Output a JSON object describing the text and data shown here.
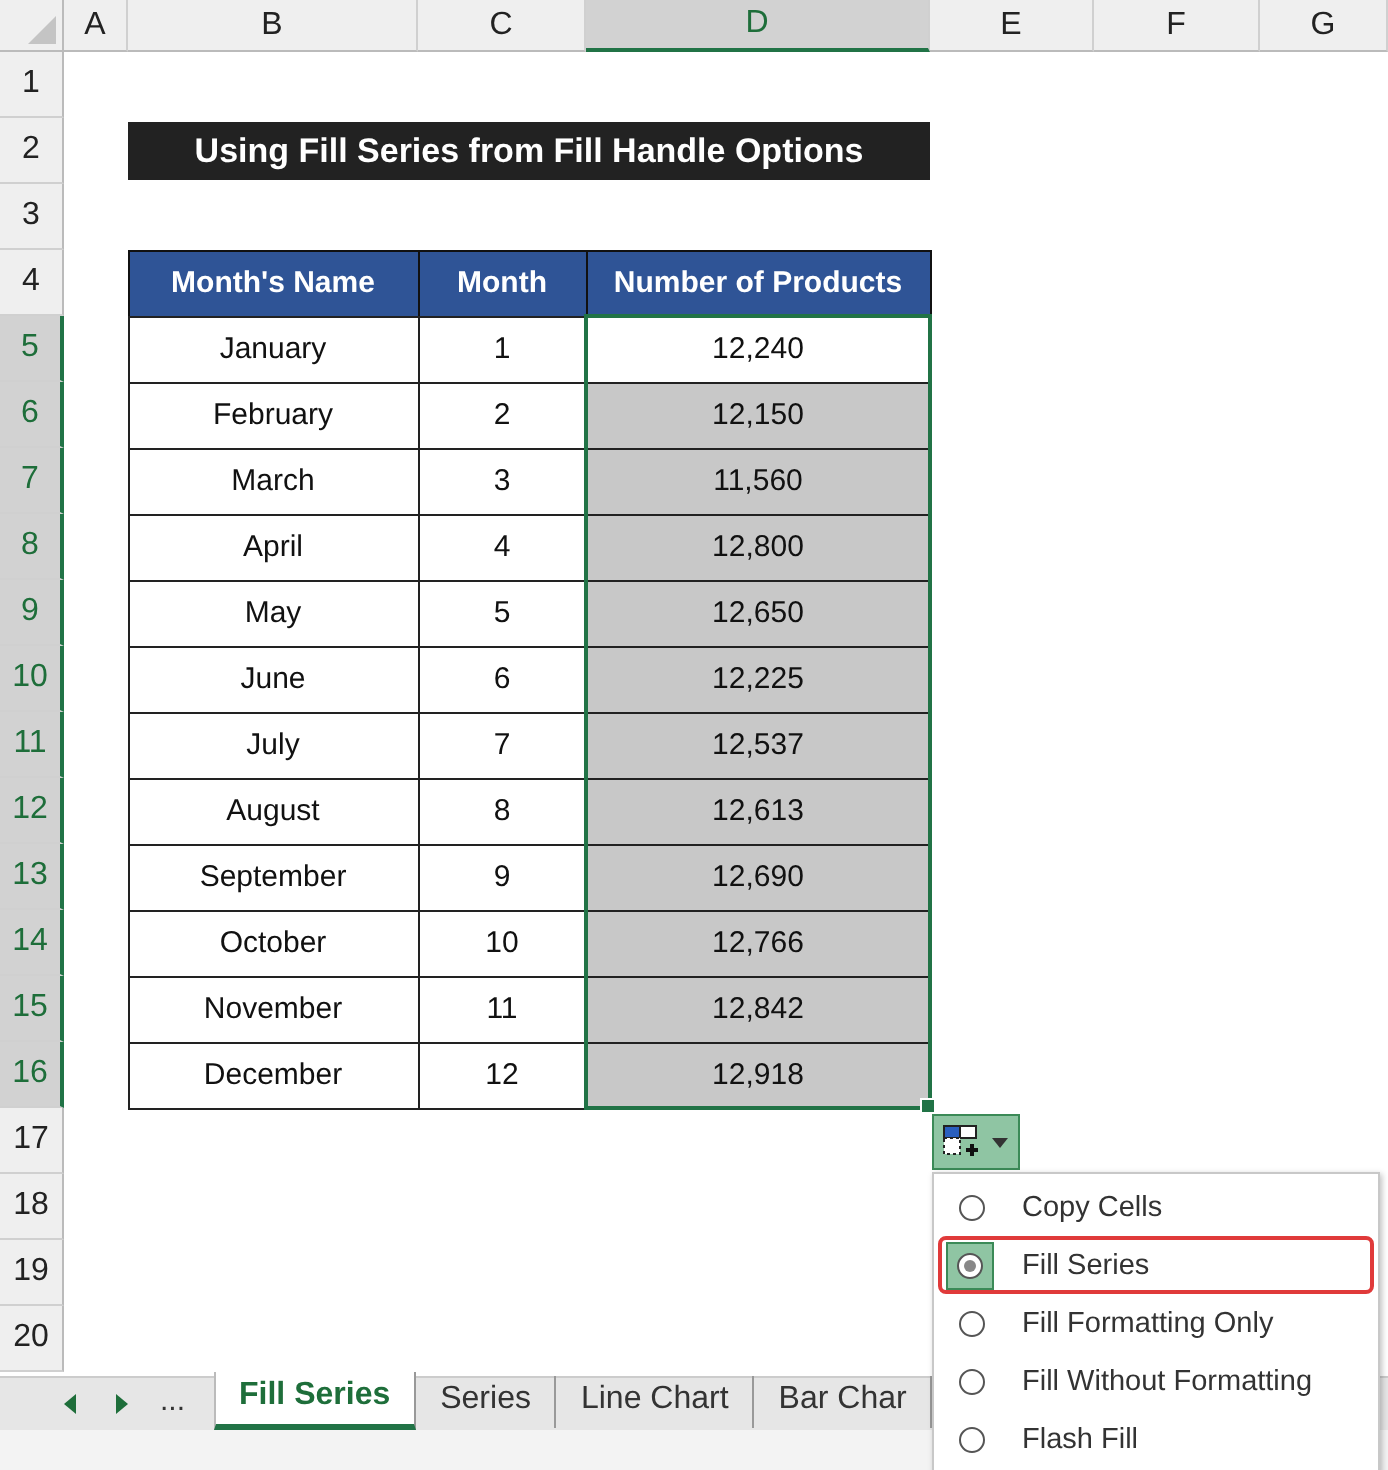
{
  "columns": [
    {
      "label": "A",
      "selected": false
    },
    {
      "label": "B",
      "selected": false
    },
    {
      "label": "C",
      "selected": false
    },
    {
      "label": "D",
      "selected": true
    },
    {
      "label": "E",
      "selected": false
    },
    {
      "label": "F",
      "selected": false
    },
    {
      "label": "G",
      "selected": false
    }
  ],
  "row_numbers": [
    {
      "label": "1",
      "selected": false
    },
    {
      "label": "2",
      "selected": false
    },
    {
      "label": "3",
      "selected": false
    },
    {
      "label": "4",
      "selected": false
    },
    {
      "label": "5",
      "selected": true
    },
    {
      "label": "6",
      "selected": true
    },
    {
      "label": "7",
      "selected": true
    },
    {
      "label": "8",
      "selected": true
    },
    {
      "label": "9",
      "selected": true
    },
    {
      "label": "10",
      "selected": true
    },
    {
      "label": "11",
      "selected": true
    },
    {
      "label": "12",
      "selected": true
    },
    {
      "label": "13",
      "selected": true
    },
    {
      "label": "14",
      "selected": true
    },
    {
      "label": "15",
      "selected": true
    },
    {
      "label": "16",
      "selected": true
    },
    {
      "label": "17",
      "selected": false
    },
    {
      "label": "18",
      "selected": false
    },
    {
      "label": "19",
      "selected": false
    },
    {
      "label": "20",
      "selected": false
    }
  ],
  "title": "Using Fill Series from Fill Handle Options",
  "table": {
    "headers": [
      "Month's Name",
      "Month",
      "Number of Products"
    ],
    "rows": [
      {
        "name": "January",
        "month": "1",
        "products": "12,240",
        "selected": false
      },
      {
        "name": "February",
        "month": "2",
        "products": "12,150",
        "selected": true
      },
      {
        "name": "March",
        "month": "3",
        "products": "11,560",
        "selected": true
      },
      {
        "name": "April",
        "month": "4",
        "products": "12,800",
        "selected": true
      },
      {
        "name": "May",
        "month": "5",
        "products": "12,650",
        "selected": true
      },
      {
        "name": "June",
        "month": "6",
        "products": "12,225",
        "selected": true
      },
      {
        "name": "July",
        "month": "7",
        "products": "12,537",
        "selected": true
      },
      {
        "name": "August",
        "month": "8",
        "products": "12,613",
        "selected": true
      },
      {
        "name": "September",
        "month": "9",
        "products": "12,690",
        "selected": true
      },
      {
        "name": "October",
        "month": "10",
        "products": "12,766",
        "selected": true
      },
      {
        "name": "November",
        "month": "11",
        "products": "12,842",
        "selected": true
      },
      {
        "name": "December",
        "month": "12",
        "products": "12,918",
        "selected": true
      }
    ]
  },
  "auto_fill_options": [
    {
      "label": "Copy Cells",
      "selected": false
    },
    {
      "label": "Fill Series",
      "selected": true
    },
    {
      "label": "Fill Formatting Only",
      "selected": false
    },
    {
      "label": "Fill Without Formatting",
      "selected": false
    },
    {
      "label": "Flash Fill",
      "selected": false
    }
  ],
  "sheet_tabs": {
    "more": "...",
    "tabs": [
      {
        "label": "Fill Series",
        "selected": true
      },
      {
        "label": "Series",
        "selected": false
      },
      {
        "label": "Line Chart",
        "selected": false
      },
      {
        "label": "Bar Char",
        "selected": false
      }
    ]
  }
}
